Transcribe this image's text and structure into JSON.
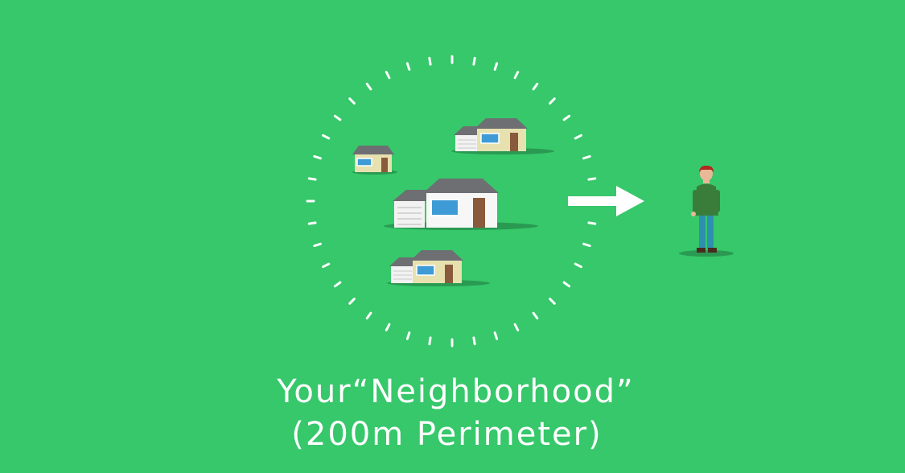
{
  "caption": {
    "line1": "Your“Neighborhood”",
    "line2": "(200m Perimeter)"
  },
  "colors": {
    "background": "#36c86a",
    "perimeter_dashes": "#ffffff",
    "arrow": "#ffffff",
    "house_beige": "#e7e1b0",
    "house_white": "#f2f2f2",
    "roof": "#6d6f73",
    "window": "#3f9bd6",
    "door": "#8a5a3c",
    "shadow": "#2a9a52",
    "person_shirt": "#3a7d3a",
    "person_pants": "#2e8fb0",
    "person_hair": "#b0281e"
  },
  "icons": [
    "dashed-perimeter-circle",
    "house-icon",
    "arrow-right-icon",
    "person-icon"
  ]
}
